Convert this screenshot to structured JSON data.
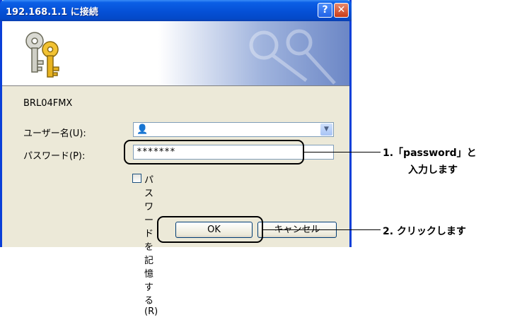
{
  "window": {
    "title": "192.168.1.1 に接続",
    "help_button": "?",
    "close_button": "✕"
  },
  "dialog": {
    "server_name": "BRL04FMX",
    "username_label": "ユーザー名(U):",
    "username_value": "",
    "password_label": "パスワード(P):",
    "password_value": "*******",
    "remember_label": "パスワードを記憶する(R)",
    "remember_checked": false,
    "ok_label": "OK",
    "cancel_label": "キャンセル"
  },
  "callouts": {
    "step1_line1": "1.「password」と",
    "step1_line2": "入力します",
    "step2": "2. クリックします"
  },
  "icons": {
    "banner": "keys-icon",
    "user": "user-icon",
    "dropdown": "chevron-down-icon"
  },
  "colors": {
    "titlebar": "#0550d6",
    "dialog_bg": "#ece9d8",
    "close": "#c93b18"
  }
}
